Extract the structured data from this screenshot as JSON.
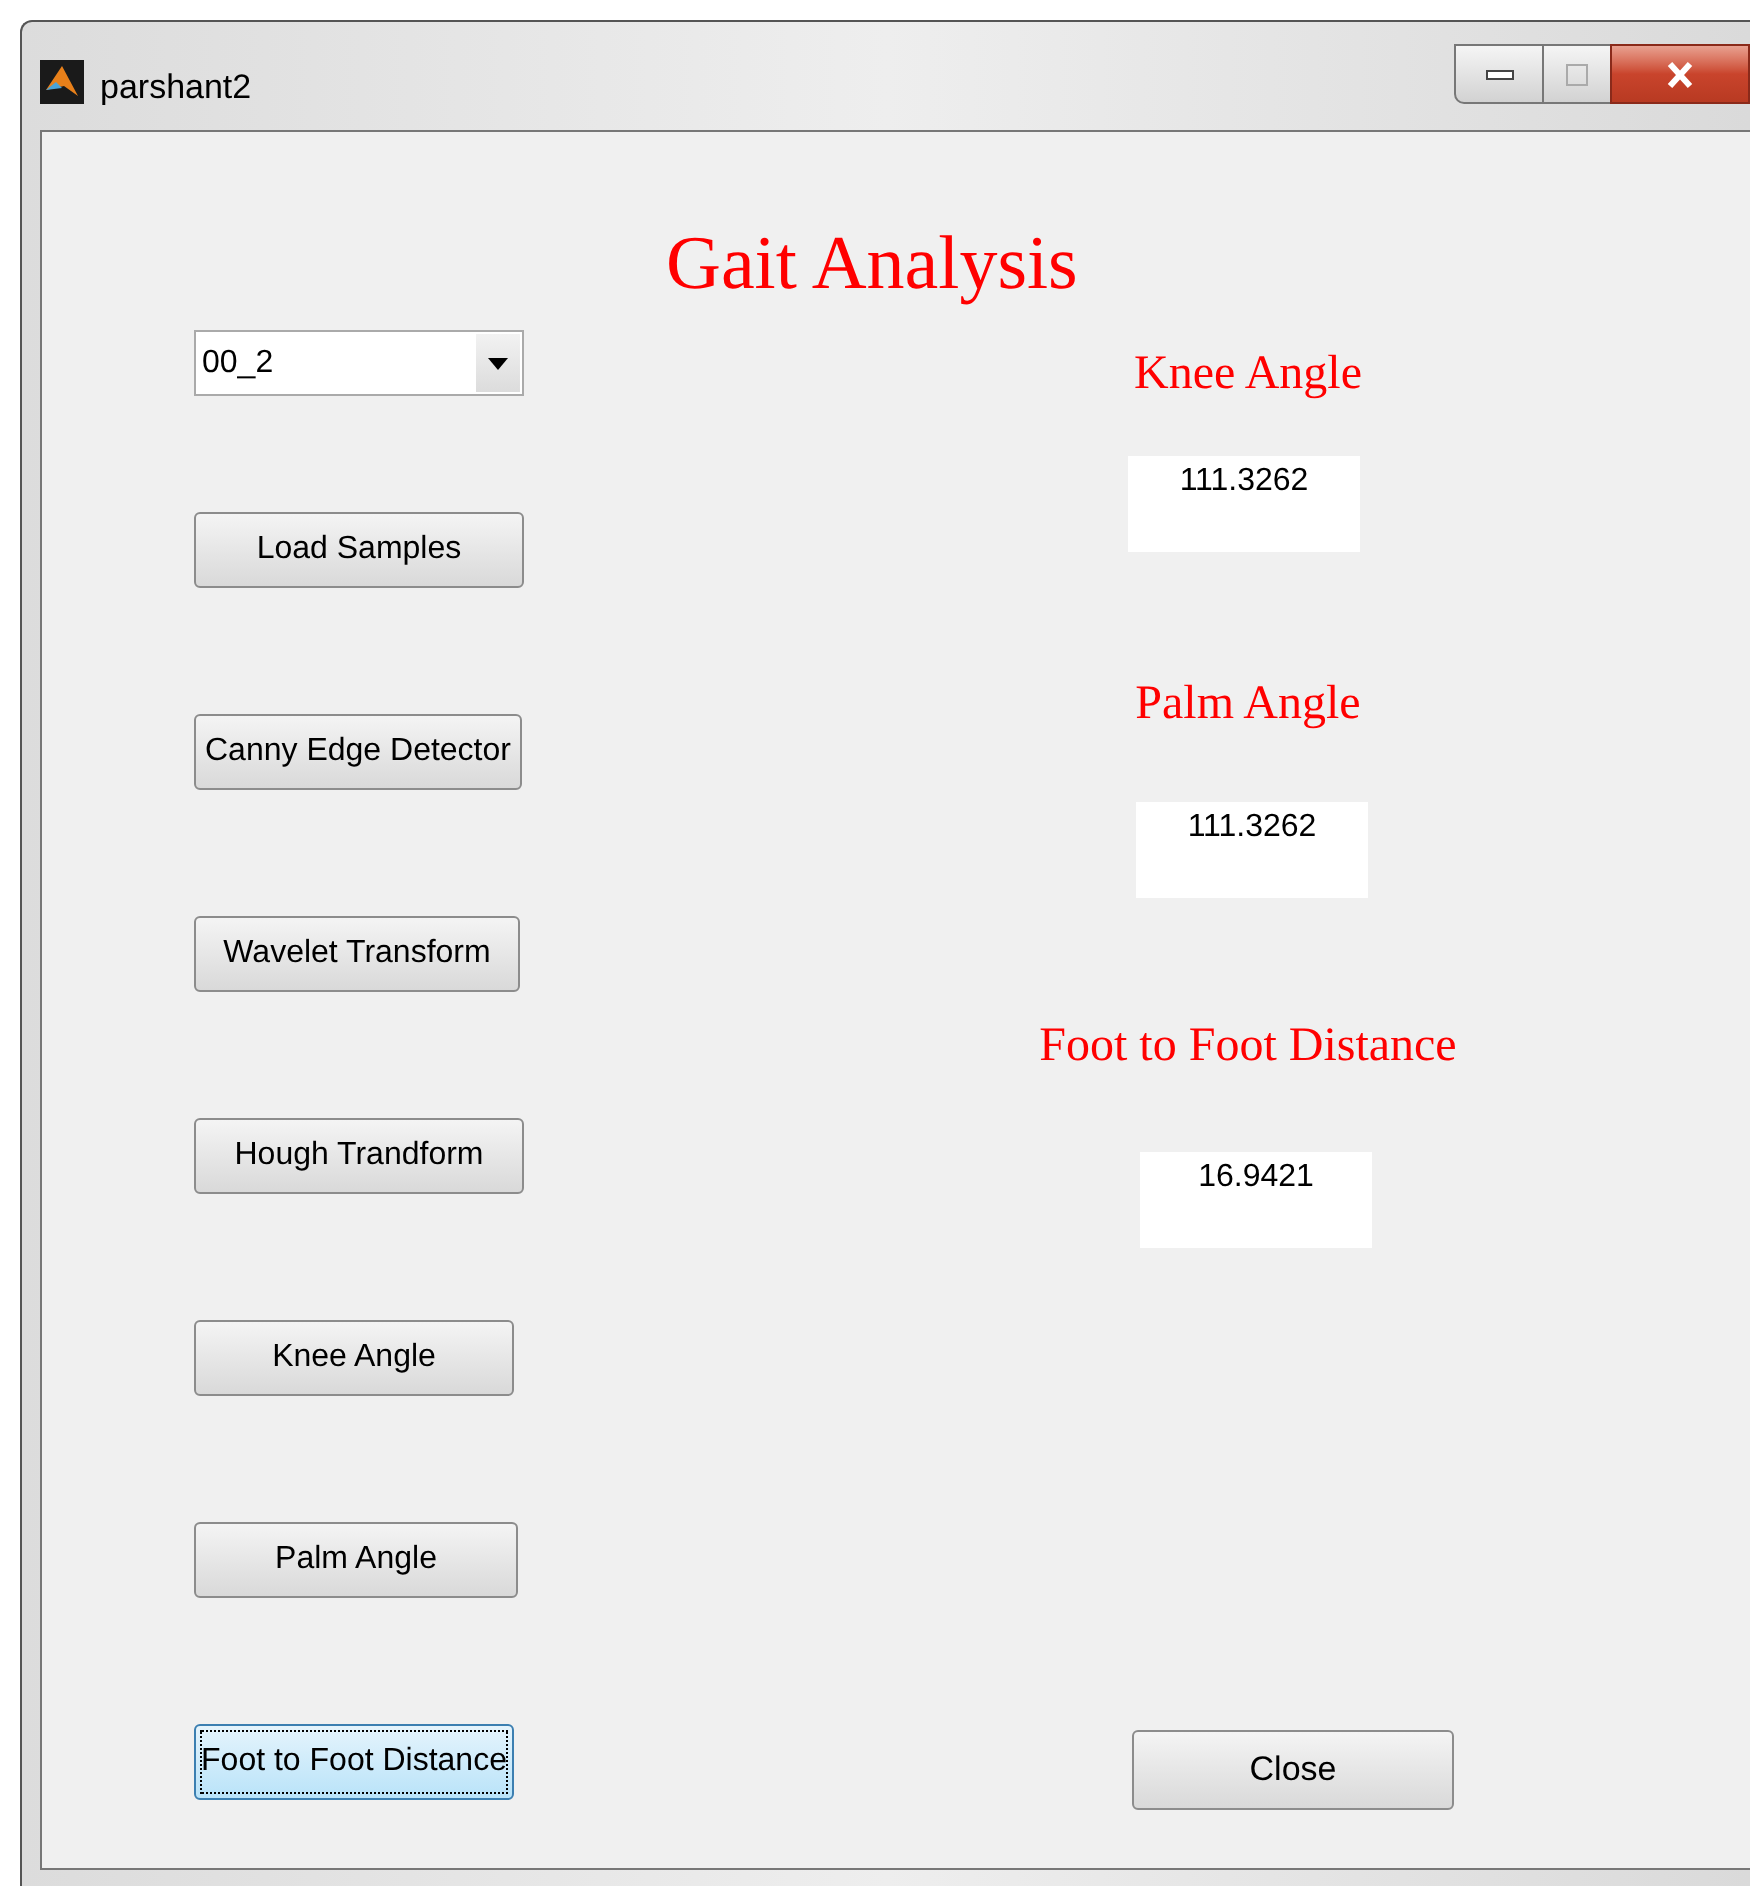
{
  "window": {
    "title": "parshant2"
  },
  "heading": "Gait Analysis",
  "sample_select": {
    "value": "00_2"
  },
  "buttons": [
    {
      "label": "Load Samples",
      "focused": false
    },
    {
      "label": "Canny Edge Detector",
      "focused": false
    },
    {
      "label": "Wavelet Transform",
      "focused": false
    },
    {
      "label": "Hough Trandform",
      "focused": false
    },
    {
      "label": "Knee Angle",
      "focused": false
    },
    {
      "label": "Palm Angle",
      "focused": false
    },
    {
      "label": "Foot to Foot Distance",
      "focused": true
    }
  ],
  "readouts": [
    {
      "label": "Knee Angle",
      "value": "111.3262"
    },
    {
      "label": "Palm Angle",
      "value": "111.3262"
    },
    {
      "label": "Foot to Foot Distance",
      "value": "16.9421"
    }
  ],
  "close_button": {
    "label": "Close"
  }
}
